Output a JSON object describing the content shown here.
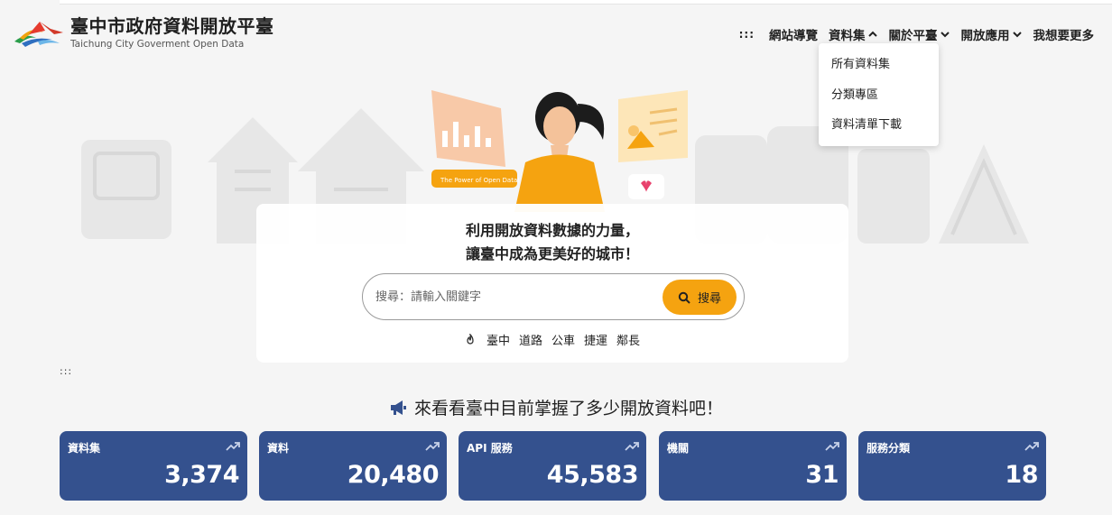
{
  "header": {
    "title": "臺中市政府資料開放平臺",
    "subtitle": "Taichung City Goverment Open Data"
  },
  "nav": {
    "dots": ":::",
    "items": [
      {
        "label": "網站導覽"
      },
      {
        "label": "資料集"
      },
      {
        "label": "關於平臺"
      },
      {
        "label": "開放應用"
      },
      {
        "label": "我想要更多"
      }
    ]
  },
  "dropdown": {
    "items": [
      "所有資料集",
      "分類專區",
      "資料清單下載"
    ]
  },
  "hero": {
    "badge": "The Power of Open Data!",
    "slogan_line1": "利用開放資料數據的力量，",
    "slogan_line2": "讓臺中成為更美好的城市！",
    "search_placeholder": "搜尋：請輸入關鍵字",
    "search_button": "搜尋",
    "hot_tags": [
      "臺中",
      "道路",
      "公車",
      "捷運",
      "鄰長"
    ]
  },
  "grip": ":::",
  "stats": {
    "heading": "來看看臺中目前掌握了多少開放資料吧！",
    "cards": [
      {
        "label": "資料集",
        "value": "3,374"
      },
      {
        "label": "資料",
        "value": "20,480"
      },
      {
        "label": "API 服務",
        "value": "45,583"
      },
      {
        "label": "機關",
        "value": "31"
      },
      {
        "label": "服務分類",
        "value": "18"
      }
    ]
  },
  "colors": {
    "accent": "#f5a310",
    "card": "#34518e",
    "background": "#f5f5f5"
  }
}
